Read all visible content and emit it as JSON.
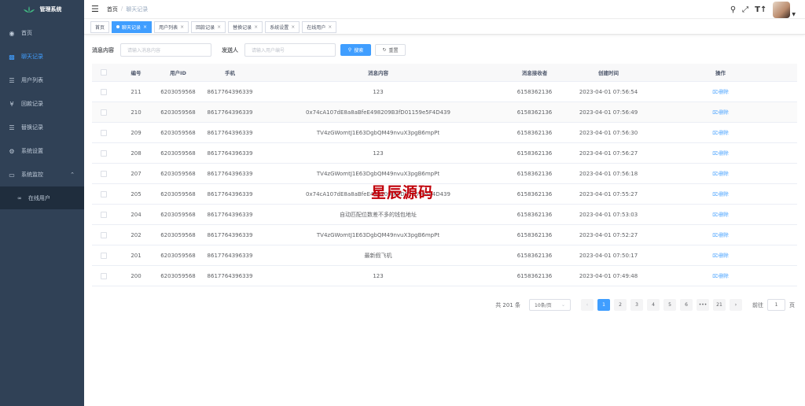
{
  "app": {
    "title": "管理系统"
  },
  "sidebar": {
    "items": [
      {
        "label": "首页",
        "icon": "dashboard-icon"
      },
      {
        "label": "聊天记录",
        "icon": "message-icon",
        "active": true
      },
      {
        "label": "用户列表",
        "icon": "list-icon"
      },
      {
        "label": "回款记录",
        "icon": "yen-icon"
      },
      {
        "label": "替换记录",
        "icon": "list-icon"
      },
      {
        "label": "系统设置",
        "icon": "gear-icon"
      },
      {
        "label": "系统监控",
        "icon": "monitor-icon"
      }
    ],
    "submenu": [
      {
        "label": "在线用户",
        "icon": "online-icon"
      }
    ]
  },
  "breadcrumb": {
    "home": "首页",
    "sep": "/",
    "current": "聊天记录"
  },
  "tags": [
    {
      "label": "首页",
      "closable": false
    },
    {
      "label": "聊天记录",
      "active": true,
      "closable": true
    },
    {
      "label": "用户列表",
      "closable": true
    },
    {
      "label": "回款记录",
      "closable": true
    },
    {
      "label": "替换记录",
      "closable": true
    },
    {
      "label": "系统设置",
      "closable": true
    },
    {
      "label": "在线用户",
      "closable": true
    }
  ],
  "search": {
    "content_label": "消息内容",
    "content_placeholder": "请输入消息内容",
    "sender_label": "发送人",
    "sender_placeholder": "请输入用户编号",
    "search_button": "搜索",
    "reset_button": "重置"
  },
  "table": {
    "headers": [
      "编号",
      "用户ID",
      "手机",
      "消息内容",
      "消息接收者",
      "创建时间",
      "操作"
    ],
    "delete_label": "删除",
    "rows": [
      [
        "211",
        "6203059568",
        "8617764396339",
        "123",
        "6158362136",
        "2023-04-01 07:56:54"
      ],
      [
        "210",
        "6203059568",
        "8617764396339",
        "0x74cA107dE8a8aBfeE498209B3fD01159e5F4D439",
        "6158362136",
        "2023-04-01 07:56:49"
      ],
      [
        "209",
        "6203059568",
        "8617764396339",
        "TV4zGWomtJ1E63DgbQM49nvuX3pgB6mpPt",
        "6158362136",
        "2023-04-01 07:56:30"
      ],
      [
        "208",
        "6203059568",
        "8617764396339",
        "123",
        "6158362136",
        "2023-04-01 07:56:27"
      ],
      [
        "207",
        "6203059568",
        "8617764396339",
        "TV4zGWomtJ1E63DgbQM49nvuX3pgB6mpPt",
        "6158362136",
        "2023-04-01 07:56:18"
      ],
      [
        "205",
        "6203059568",
        "8617764396339",
        "0x74cA107dE8a8aBfeE498209B3fD01159e5F4D439",
        "6158362136",
        "2023-04-01 07:55:27"
      ],
      [
        "204",
        "6203059568",
        "8617764396339",
        "自动匹配位数差不多的钱包地址",
        "6158362136",
        "2023-04-01 07:53:03"
      ],
      [
        "202",
        "6203059568",
        "8617764396339",
        "TV4zGWomtJ1E63DgbQM49nvuX3pgB6mpPt",
        "6158362136",
        "2023-04-01 07:52:27"
      ],
      [
        "201",
        "6203059568",
        "8617764396339",
        "最新假飞机",
        "6158362136",
        "2023-04-01 07:50:17"
      ],
      [
        "200",
        "6203059568",
        "8617764396339",
        "123",
        "6158362136",
        "2023-04-01 07:49:48"
      ]
    ]
  },
  "watermark": "星辰源码",
  "pagination": {
    "total": "共 201 条",
    "page_size": "10条/页",
    "pages": [
      "1",
      "2",
      "3",
      "4",
      "5",
      "6",
      "•••",
      "21"
    ],
    "current": "1",
    "goto_prefix": "前往",
    "goto_value": "1",
    "goto_suffix": "页"
  },
  "colors": {
    "sidebar": "#304156",
    "accent": "#409eff",
    "submenu": "#1f2d3d",
    "watermark": "#c0000a"
  }
}
